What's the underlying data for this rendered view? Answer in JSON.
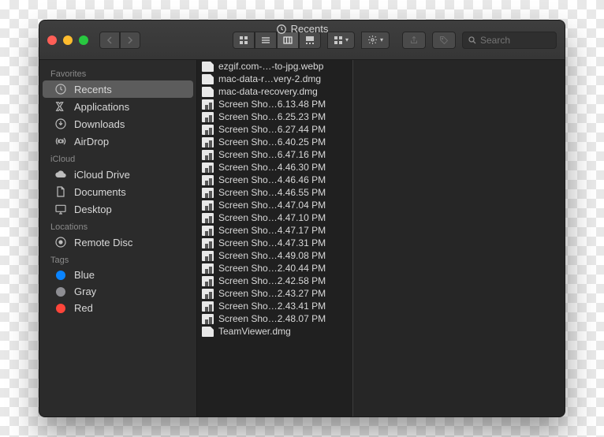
{
  "window": {
    "title": "Recents",
    "search_placeholder": "Search"
  },
  "sidebar": {
    "sections": [
      {
        "header": "Favorites",
        "items": [
          {
            "icon": "clock",
            "label": "Recents",
            "selected": true
          },
          {
            "icon": "app",
            "label": "Applications"
          },
          {
            "icon": "download",
            "label": "Downloads"
          },
          {
            "icon": "airdrop",
            "label": "AirDrop"
          }
        ]
      },
      {
        "header": "iCloud",
        "items": [
          {
            "icon": "cloud",
            "label": "iCloud Drive"
          },
          {
            "icon": "doc",
            "label": "Documents"
          },
          {
            "icon": "desktop",
            "label": "Desktop"
          }
        ]
      },
      {
        "header": "Locations",
        "items": [
          {
            "icon": "disc",
            "label": "Remote Disc"
          }
        ]
      },
      {
        "header": "Tags",
        "items": [
          {
            "icon": "tag",
            "color": "#0a84ff",
            "label": "Blue"
          },
          {
            "icon": "tag",
            "color": "#8e8e93",
            "label": "Gray"
          },
          {
            "icon": "tag",
            "color": "#ff453a",
            "label": "Red"
          }
        ]
      }
    ]
  },
  "files": [
    {
      "type": "doc",
      "name": "ezgif.com-…-to-jpg.webp"
    },
    {
      "type": "doc",
      "name": "mac-data-r…very-2.dmg"
    },
    {
      "type": "doc",
      "name": "mac-data-recovery.dmg"
    },
    {
      "type": "img",
      "name": "Screen Sho…6.13.48 PM"
    },
    {
      "type": "img",
      "name": "Screen Sho…6.25.23 PM"
    },
    {
      "type": "img",
      "name": "Screen Sho…6.27.44 PM"
    },
    {
      "type": "img",
      "name": "Screen Sho…6.40.25 PM"
    },
    {
      "type": "img",
      "name": "Screen Sho…6.47.16 PM"
    },
    {
      "type": "img",
      "name": "Screen Sho…4.46.30 PM"
    },
    {
      "type": "img",
      "name": "Screen Sho…4.46.46 PM"
    },
    {
      "type": "img",
      "name": "Screen Sho…4.46.55 PM"
    },
    {
      "type": "img",
      "name": "Screen Sho…4.47.04 PM"
    },
    {
      "type": "img",
      "name": "Screen Sho…4.47.10 PM"
    },
    {
      "type": "img",
      "name": "Screen Sho…4.47.17 PM"
    },
    {
      "type": "img",
      "name": "Screen Sho…4.47.31 PM"
    },
    {
      "type": "img",
      "name": "Screen Sho…4.49.08 PM"
    },
    {
      "type": "img",
      "name": "Screen Sho…2.40.44 PM"
    },
    {
      "type": "img",
      "name": "Screen Sho…2.42.58 PM"
    },
    {
      "type": "img",
      "name": "Screen Sho…2.43.27 PM"
    },
    {
      "type": "img",
      "name": "Screen Sho…2.43.41 PM"
    },
    {
      "type": "img",
      "name": "Screen Sho…2.48.07 PM"
    },
    {
      "type": "doc",
      "name": "TeamViewer.dmg"
    }
  ]
}
